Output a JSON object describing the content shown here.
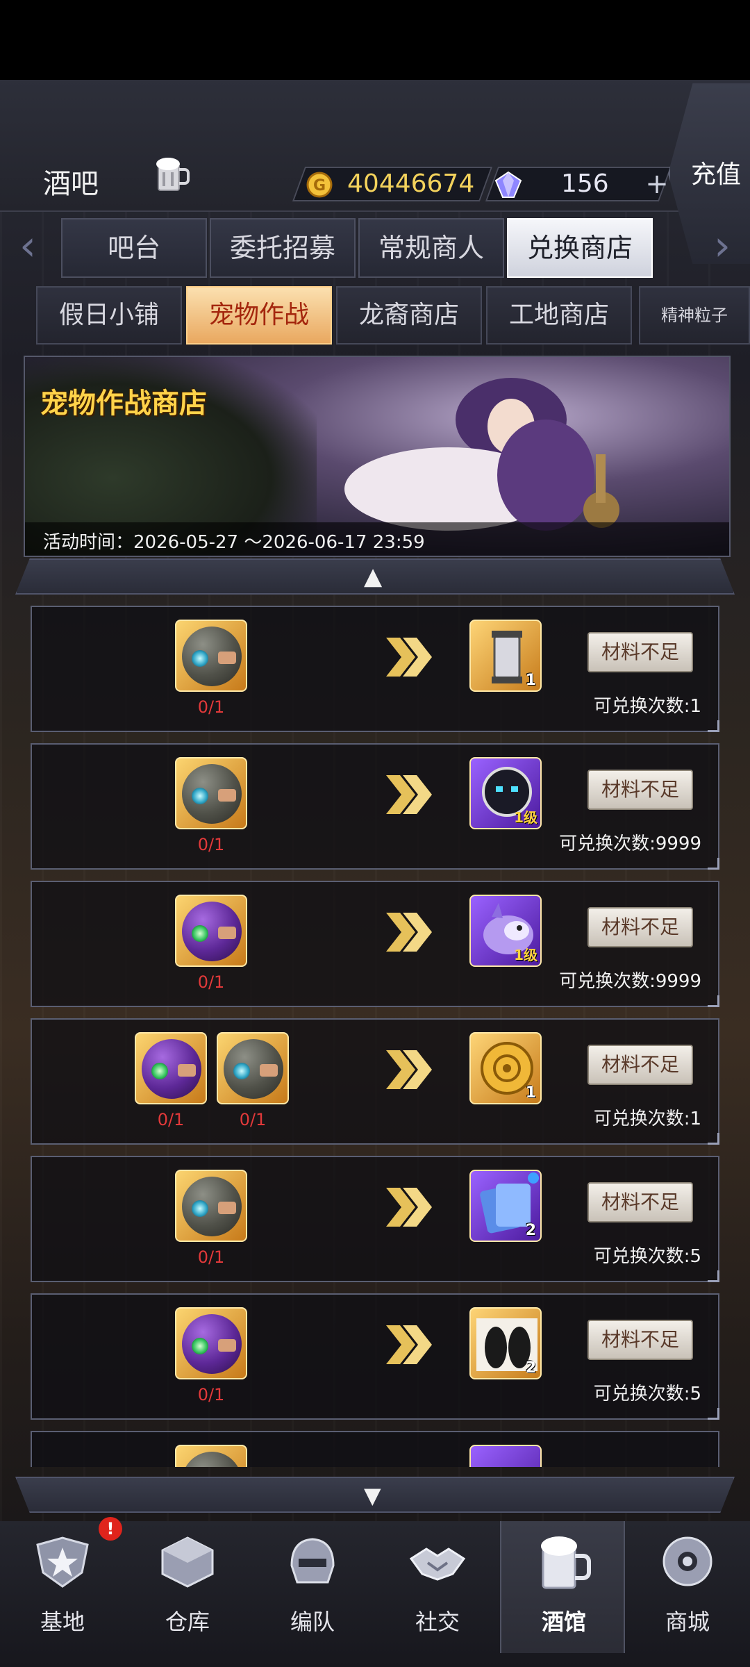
{
  "header": {
    "location": "酒吧",
    "gold": "40446674",
    "gems": "156",
    "plus": "+",
    "recharge": "充值"
  },
  "main_tabs": [
    "吧台",
    "委托招募",
    "常规商人",
    "兑换商店"
  ],
  "active_main_tab": "兑换商店",
  "sub_tabs": [
    "假日小铺",
    "宠物作战",
    "龙裔商店",
    "工地商店",
    "精神粒子"
  ],
  "active_sub_tab": "宠物作战",
  "banner": {
    "title": "宠物作战商店",
    "time": "活动时间：2026-05-27 ～2026-06-17 23:59"
  },
  "collapse": "▲",
  "expand": "▼",
  "rows": [
    {
      "materials": [
        {
          "type": "gray-orb",
          "count": "0/1"
        }
      ],
      "reward": {
        "type": "lantern",
        "qty": "1"
      },
      "button": "材料不足",
      "limit": "可兑换次数:1"
    },
    {
      "materials": [
        {
          "type": "gray-orb",
          "count": "0/1"
        }
      ],
      "reward": {
        "type": "robot-pet",
        "qty": "1级"
      },
      "button": "材料不足",
      "limit": "可兑换次数:9999"
    },
    {
      "materials": [
        {
          "type": "purple-orb",
          "count": "0/1"
        }
      ],
      "reward": {
        "type": "dragon-pet",
        "qty": "1级"
      },
      "button": "材料不足",
      "limit": "可兑换次数:9999"
    },
    {
      "materials": [
        {
          "type": "purple-orb",
          "count": "0/1"
        },
        {
          "type": "gray-orb",
          "count": "0/1"
        }
      ],
      "reward": {
        "type": "gold-medal",
        "qty": "1"
      },
      "button": "材料不足",
      "limit": "可兑换次数:1"
    },
    {
      "materials": [
        {
          "type": "gray-orb",
          "count": "0/1"
        }
      ],
      "reward": {
        "type": "card-pack",
        "qty": "2"
      },
      "button": "材料不足",
      "limit": "可兑换次数:5"
    },
    {
      "materials": [
        {
          "type": "purple-orb",
          "count": "0/1"
        }
      ],
      "reward": {
        "type": "silhouette-card",
        "qty": "2"
      },
      "button": "材料不足",
      "limit": "可兑换次数:5"
    }
  ],
  "nav": [
    {
      "label": "基地",
      "icon": "star-emblem-icon",
      "badge": "!"
    },
    {
      "label": "仓库",
      "icon": "warehouse-icon"
    },
    {
      "label": "编队",
      "icon": "helmet-icon"
    },
    {
      "label": "社交",
      "icon": "handshake-icon"
    },
    {
      "label": "酒馆",
      "icon": "beer-mug-icon",
      "active": true
    },
    {
      "label": "商城",
      "icon": "shop-orb-icon"
    }
  ]
}
